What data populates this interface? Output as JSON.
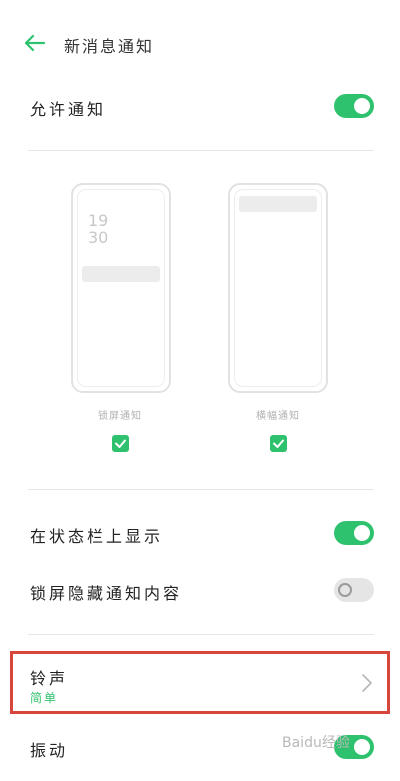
{
  "header": {
    "title": "新消息通知"
  },
  "allow_notifications": {
    "label": "允许通知",
    "enabled": true
  },
  "preview": {
    "lock_screen": {
      "time_hour": "19",
      "time_minute": "30",
      "caption": "锁屏通知",
      "checked": true
    },
    "banner": {
      "caption": "横幅通知",
      "checked": true
    }
  },
  "status_bar": {
    "label": "在状态栏上显示",
    "enabled": true
  },
  "hide_lock_content": {
    "label": "锁屏隐藏通知内容",
    "enabled": false
  },
  "ringtone": {
    "label": "铃声",
    "value": "简单"
  },
  "vibrate": {
    "label": "振动",
    "enabled": true
  },
  "watermark": {
    "text": "Baidu经验"
  },
  "colors": {
    "accent": "#2fc26e",
    "highlight": "#d8453a"
  }
}
